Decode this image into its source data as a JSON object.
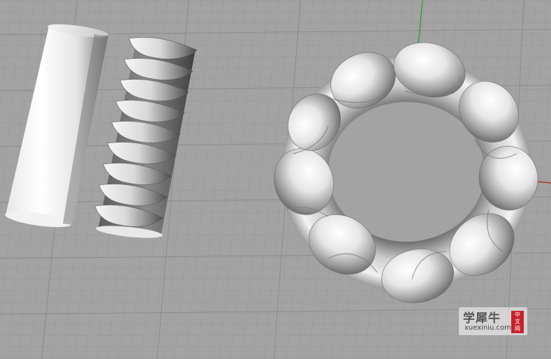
{
  "viewport": {
    "background_color": "#a3a3a3",
    "grid_minor_color": "#969696",
    "grid_major_color": "#8c8c8c",
    "axis_x_color": "#b02020",
    "axis_y_color": "#1ea01e",
    "objects": [
      "capsule-surface",
      "twisted-helix-column",
      "twisted-torus-ring"
    ]
  },
  "watermark": {
    "title": "学犀牛",
    "url": "xuexiniu.com",
    "badge": [
      "中",
      "文",
      "网"
    ],
    "badge_color": "#c8202a"
  }
}
